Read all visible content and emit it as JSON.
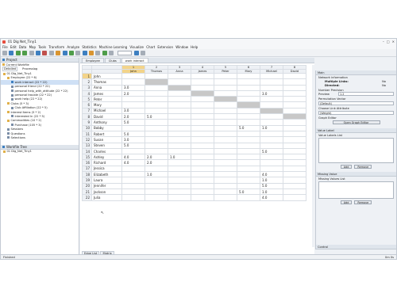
{
  "window": {
    "title": "01 Dig Net_Tiny1"
  },
  "menu": [
    "File",
    "Edit",
    "Data",
    "Map",
    "Tools",
    "Transform",
    "Analyze",
    "Statistics",
    "Machine Learning",
    "Visualize",
    "Chart",
    "Extension",
    "Window",
    "Help"
  ],
  "left": {
    "panel_title": "Project",
    "current_workfile": "Current Workfile",
    "subtabs": [
      "Detailed",
      "Processlog"
    ],
    "tree": [
      {
        "label": "01 Dig_Net_Tiny1",
        "indent": 0,
        "kind": "folder"
      },
      {
        "label": "Employee (22 * 6)",
        "indent": 1,
        "kind": "folder"
      },
      {
        "label": "work interact (22 * 22)",
        "indent": 2,
        "kind": "sel"
      },
      {
        "label": "personal friend (22 * 22)",
        "indent": 2,
        "kind": "item"
      },
      {
        "label": "personal help_with_attitude (22 * 22)",
        "indent": 2,
        "kind": "item"
      },
      {
        "label": "personal trouble (22 * 22)",
        "indent": 2,
        "kind": "item"
      },
      {
        "label": "work help (22 * 22)",
        "indent": 2,
        "kind": "item"
      },
      {
        "label": "Clubs (5 * 3)",
        "indent": 1,
        "kind": "folder"
      },
      {
        "label": "Club Affiliation (22 * 5)",
        "indent": 2,
        "kind": "item"
      },
      {
        "label": "Interest Items (5 * 2)",
        "indent": 1,
        "kind": "folder"
      },
      {
        "label": "Interested In (22 * 5)",
        "indent": 2,
        "kind": "item"
      },
      {
        "label": "Commodities (10 * 2)",
        "indent": 1,
        "kind": "folder"
      },
      {
        "label": "Purchase (105 * 3)",
        "indent": 2,
        "kind": "item"
      },
      {
        "label": "Sessions",
        "indent": 1,
        "kind": "item"
      },
      {
        "label": "Questions",
        "indent": 1,
        "kind": "item"
      },
      {
        "label": "Selections",
        "indent": 1,
        "kind": "item"
      }
    ],
    "workfile_tree_title": "Workfile Tree",
    "workfile_tree_item": "01 Dig_Net_Tiny1"
  },
  "center": {
    "tabs": [
      "Employee",
      "Clubs",
      "work interact"
    ],
    "active_tab": 2,
    "col_numbers": [
      "1",
      "2",
      "3",
      "4",
      "5",
      "6",
      "7",
      "8"
    ],
    "col_names": [
      "John",
      "Thomas",
      "Anna",
      "James",
      "Peter",
      "Mary",
      "Michael",
      "David"
    ],
    "rows": [
      {
        "n": "1",
        "name": "John",
        "cells": [
          "",
          "",
          "",
          "",
          "",
          "",
          "",
          ""
        ]
      },
      {
        "n": "2",
        "name": "Thomas",
        "cells": [
          "",
          "",
          "",
          "",
          "",
          "",
          "",
          ""
        ]
      },
      {
        "n": "3",
        "name": "Anna",
        "cells": [
          "3.0",
          "",
          "",
          "",
          "",
          "",
          "",
          ""
        ]
      },
      {
        "n": "4",
        "name": "James",
        "cells": [
          "2.0",
          "",
          "",
          "",
          "",
          "",
          "3.0",
          ""
        ]
      },
      {
        "n": "5",
        "name": "Peter",
        "cells": [
          "",
          "",
          "",
          "",
          "",
          "",
          "",
          ""
        ]
      },
      {
        "n": "6",
        "name": "Mary",
        "cells": [
          "",
          "",
          "",
          "",
          "",
          "",
          "",
          ""
        ]
      },
      {
        "n": "7",
        "name": "Michael",
        "cells": [
          "3.0",
          "",
          "",
          "",
          "",
          "",
          "",
          ""
        ]
      },
      {
        "n": "8",
        "name": "David",
        "cells": [
          "2.0",
          "5.0",
          "",
          "",
          "",
          "",
          "",
          ""
        ]
      },
      {
        "n": "9",
        "name": "Anthony",
        "cells": [
          "5.0",
          "",
          "",
          "",
          "",
          "",
          "",
          ""
        ]
      },
      {
        "n": "10",
        "name": "Bobby",
        "cells": [
          "",
          "",
          "",
          "",
          "",
          "5.0",
          "1.0",
          ""
        ]
      },
      {
        "n": "11",
        "name": "Robert",
        "cells": [
          "5.0",
          "",
          "",
          "",
          "",
          "",
          "",
          ""
        ]
      },
      {
        "n": "12",
        "name": "Susan",
        "cells": [
          "3.0",
          "",
          "",
          "",
          "",
          "",
          "",
          ""
        ]
      },
      {
        "n": "13",
        "name": "Steven",
        "cells": [
          "5.0",
          "",
          "",
          "",
          "",
          "",
          "",
          ""
        ]
      },
      {
        "n": "14",
        "name": "Charles",
        "cells": [
          "",
          "",
          "",
          "",
          "",
          "",
          "5.0",
          ""
        ]
      },
      {
        "n": "15",
        "name": "Ashley",
        "cells": [
          "4.0",
          "2.0",
          "1.0",
          "",
          "",
          "",
          "",
          ""
        ]
      },
      {
        "n": "16",
        "name": "Richard",
        "cells": [
          "4.0",
          "2.0",
          "",
          "",
          "",
          "",
          "",
          ""
        ]
      },
      {
        "n": "17",
        "name": "Jessica",
        "cells": [
          "",
          "",
          "",
          "",
          "",
          "",
          "",
          ""
        ]
      },
      {
        "n": "18",
        "name": "Elizabeth",
        "cells": [
          "",
          "1.0",
          "",
          "",
          "",
          "",
          "4.0",
          ""
        ]
      },
      {
        "n": "19",
        "name": "Laura",
        "cells": [
          "",
          "",
          "",
          "",
          "",
          "",
          "1.0",
          ""
        ]
      },
      {
        "n": "20",
        "name": "Jennifer",
        "cells": [
          "",
          "",
          "",
          "",
          "",
          "",
          "5.0",
          ""
        ]
      },
      {
        "n": "21",
        "name": "Jackson",
        "cells": [
          "",
          "",
          "",
          "",
          "",
          "5.0",
          "1.0",
          ""
        ]
      },
      {
        "n": "22",
        "name": "Julia",
        "cells": [
          "",
          "",
          "",
          "",
          "",
          "",
          "4.0",
          ""
        ]
      }
    ],
    "bottom_tabs": [
      "Edge List",
      "Matrix"
    ]
  },
  "right": {
    "panel_title": "Main",
    "network_info": "Network information",
    "multiple_links_label": "Multiple Links:",
    "multiple_links_value": "No",
    "directed_label": "Directed:",
    "directed_value": "No",
    "number_precision": "Number Precision",
    "preview_label": "Preview",
    "preview_value": "1.2",
    "permutation_vector": "Permutation Vector",
    "permutation_value": "(Default)",
    "link_attribute": "Choose Link Attribute",
    "link_attribute_value": "(Weight)",
    "graph_editor": "Graph Editor",
    "open_graph_editor": "Open Graph Editor",
    "value_label_title": "Value Label",
    "value_labels_list": "Value Labels List",
    "add": "Add",
    "remove": "Remove",
    "missing_value_title": "Missing Value",
    "missing_values_list": "Missing Values List",
    "control": "Control"
  },
  "status": {
    "left": "Finished",
    "right": "0m 0s"
  }
}
